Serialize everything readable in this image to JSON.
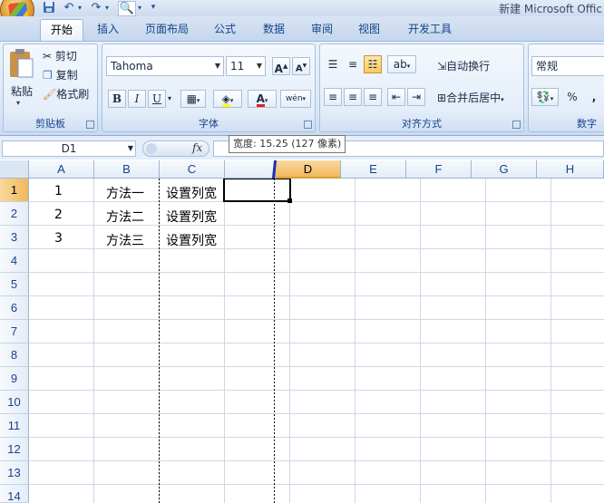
{
  "app": {
    "title": "新建 Microsoft Offic"
  },
  "quick_access": {
    "save_icon": "save-icon",
    "undo_icon": "undo-icon",
    "redo_icon": "redo-icon",
    "preview_icon": "print-preview-icon"
  },
  "tabs": [
    {
      "label": "开始",
      "active": true
    },
    {
      "label": "插入"
    },
    {
      "label": "页面布局"
    },
    {
      "label": "公式"
    },
    {
      "label": "数据"
    },
    {
      "label": "审阅"
    },
    {
      "label": "视图"
    },
    {
      "label": "开发工具"
    }
  ],
  "clipboard": {
    "paste": "粘贴",
    "cut": "剪切",
    "copy": "复制",
    "format_painter": "格式刷",
    "group": "剪贴板"
  },
  "font": {
    "name": "Tahoma",
    "size": "11",
    "bold": "B",
    "italic": "I",
    "underline": "U",
    "grow": "A",
    "shrink": "A",
    "font_color_letter": "A",
    "phonetic": "wén",
    "group": "字体"
  },
  "alignment": {
    "wrap": "自动换行",
    "merge": "合并后居中",
    "group": "对齐方式"
  },
  "number": {
    "format": "常规",
    "percent": "%",
    "comma": ",",
    "group": "数字"
  },
  "formula_bar": {
    "name_box": "D1",
    "fx": "fx"
  },
  "tooltip": "宽度: 15.25 (127 像素)",
  "columns": [
    "A",
    "B",
    "C",
    "D",
    "E",
    "F",
    "G",
    "H"
  ],
  "selected_column": "D",
  "rows": [
    "1",
    "2",
    "3",
    "4",
    "5",
    "6",
    "7",
    "8",
    "9",
    "10",
    "11",
    "12",
    "13",
    "14"
  ],
  "selected_row": "1",
  "cells": {
    "A1": "1",
    "B1": "方法一",
    "C1": "设置列宽",
    "A2": "2",
    "B2": "方法二",
    "C2": "设置列宽",
    "A3": "3",
    "B3": "方法三",
    "C3": "设置列宽"
  },
  "colors": {
    "accent": "#15428b",
    "selected_header": "#f1b85a",
    "ribbon_bg": "#dce8f6"
  }
}
